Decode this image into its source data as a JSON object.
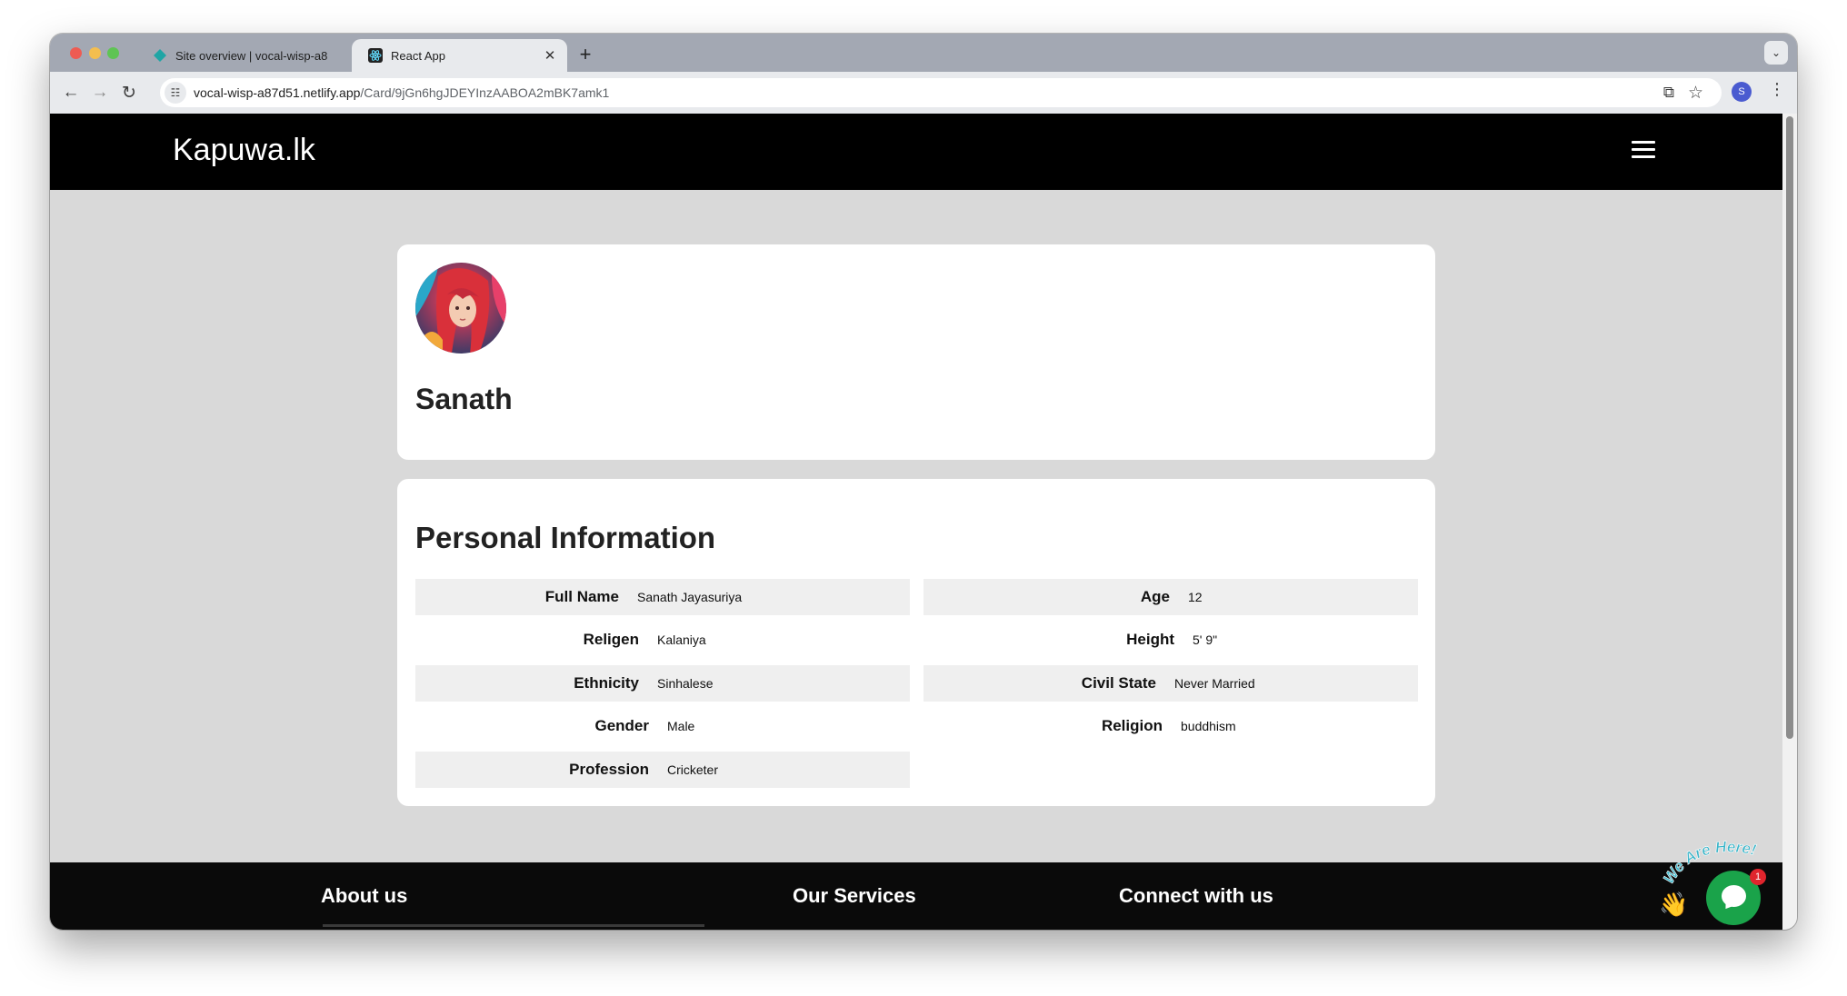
{
  "browser": {
    "tabs": [
      {
        "title": "Site overview | vocal-wisp-a8",
        "active": false
      },
      {
        "title": "React App",
        "active": true
      }
    ],
    "url_host": "vocal-wisp-a87d51.netlify.app",
    "url_path": "/Card/9jGn6hgJDEYInzAABOA2mBK7amk1",
    "profile_initial": "S"
  },
  "site": {
    "brand": "Kapuwa.lk"
  },
  "profile": {
    "name": "Sanath"
  },
  "personal_info": {
    "title": "Personal Information",
    "left": [
      {
        "label": "Full Name",
        "value": "Sanath Jayasuriya"
      },
      {
        "label": "Religen",
        "value": "Kalaniya"
      },
      {
        "label": "Ethnicity",
        "value": "Sinhalese"
      },
      {
        "label": "Gender",
        "value": "Male"
      },
      {
        "label": "Profession",
        "value": "Cricketer"
      }
    ],
    "right": [
      {
        "label": "Age",
        "value": "12"
      },
      {
        "label": "Height",
        "value": "5' 9\""
      },
      {
        "label": "Civil State",
        "value": "Never Married"
      },
      {
        "label": "Religion",
        "value": "buddhism"
      }
    ]
  },
  "footer": {
    "about": "About us",
    "services": "Our Services",
    "connect": "Connect with us"
  },
  "chat": {
    "tagline": "We Are Here!",
    "badge": "1"
  },
  "colors": {
    "header": "#000000",
    "page_bg": "#d9d9d9",
    "chat_green": "#1aa34a"
  }
}
